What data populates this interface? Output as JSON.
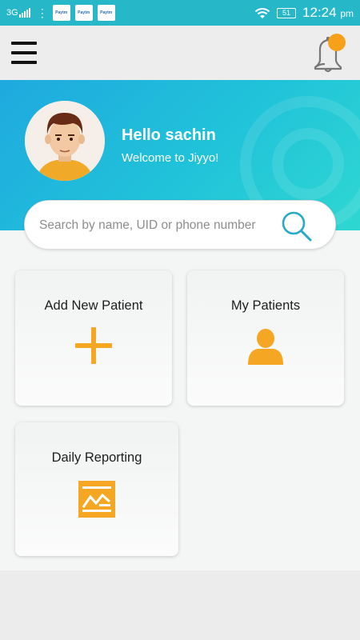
{
  "status_bar": {
    "network": "3G",
    "apps": [
      "Paytm",
      "Paytm",
      "Paytm"
    ],
    "battery": "51",
    "time": "12:24",
    "ampm": "pm"
  },
  "header": {
    "greeting": "Hello sachin",
    "welcome": "Welcome to Jiyyo!"
  },
  "search": {
    "placeholder": "Search by name, UID or phone number"
  },
  "cards": [
    {
      "label": "Add New Patient",
      "icon": "plus-icon"
    },
    {
      "label": "My Patients",
      "icon": "person-icon"
    },
    {
      "label": "Daily Reporting",
      "icon": "report-icon"
    }
  ],
  "colors": {
    "accent": "#f5a623",
    "header_start": "#1fa9df",
    "header_end": "#2fd7d2",
    "status_bar": "#26b7c9"
  }
}
